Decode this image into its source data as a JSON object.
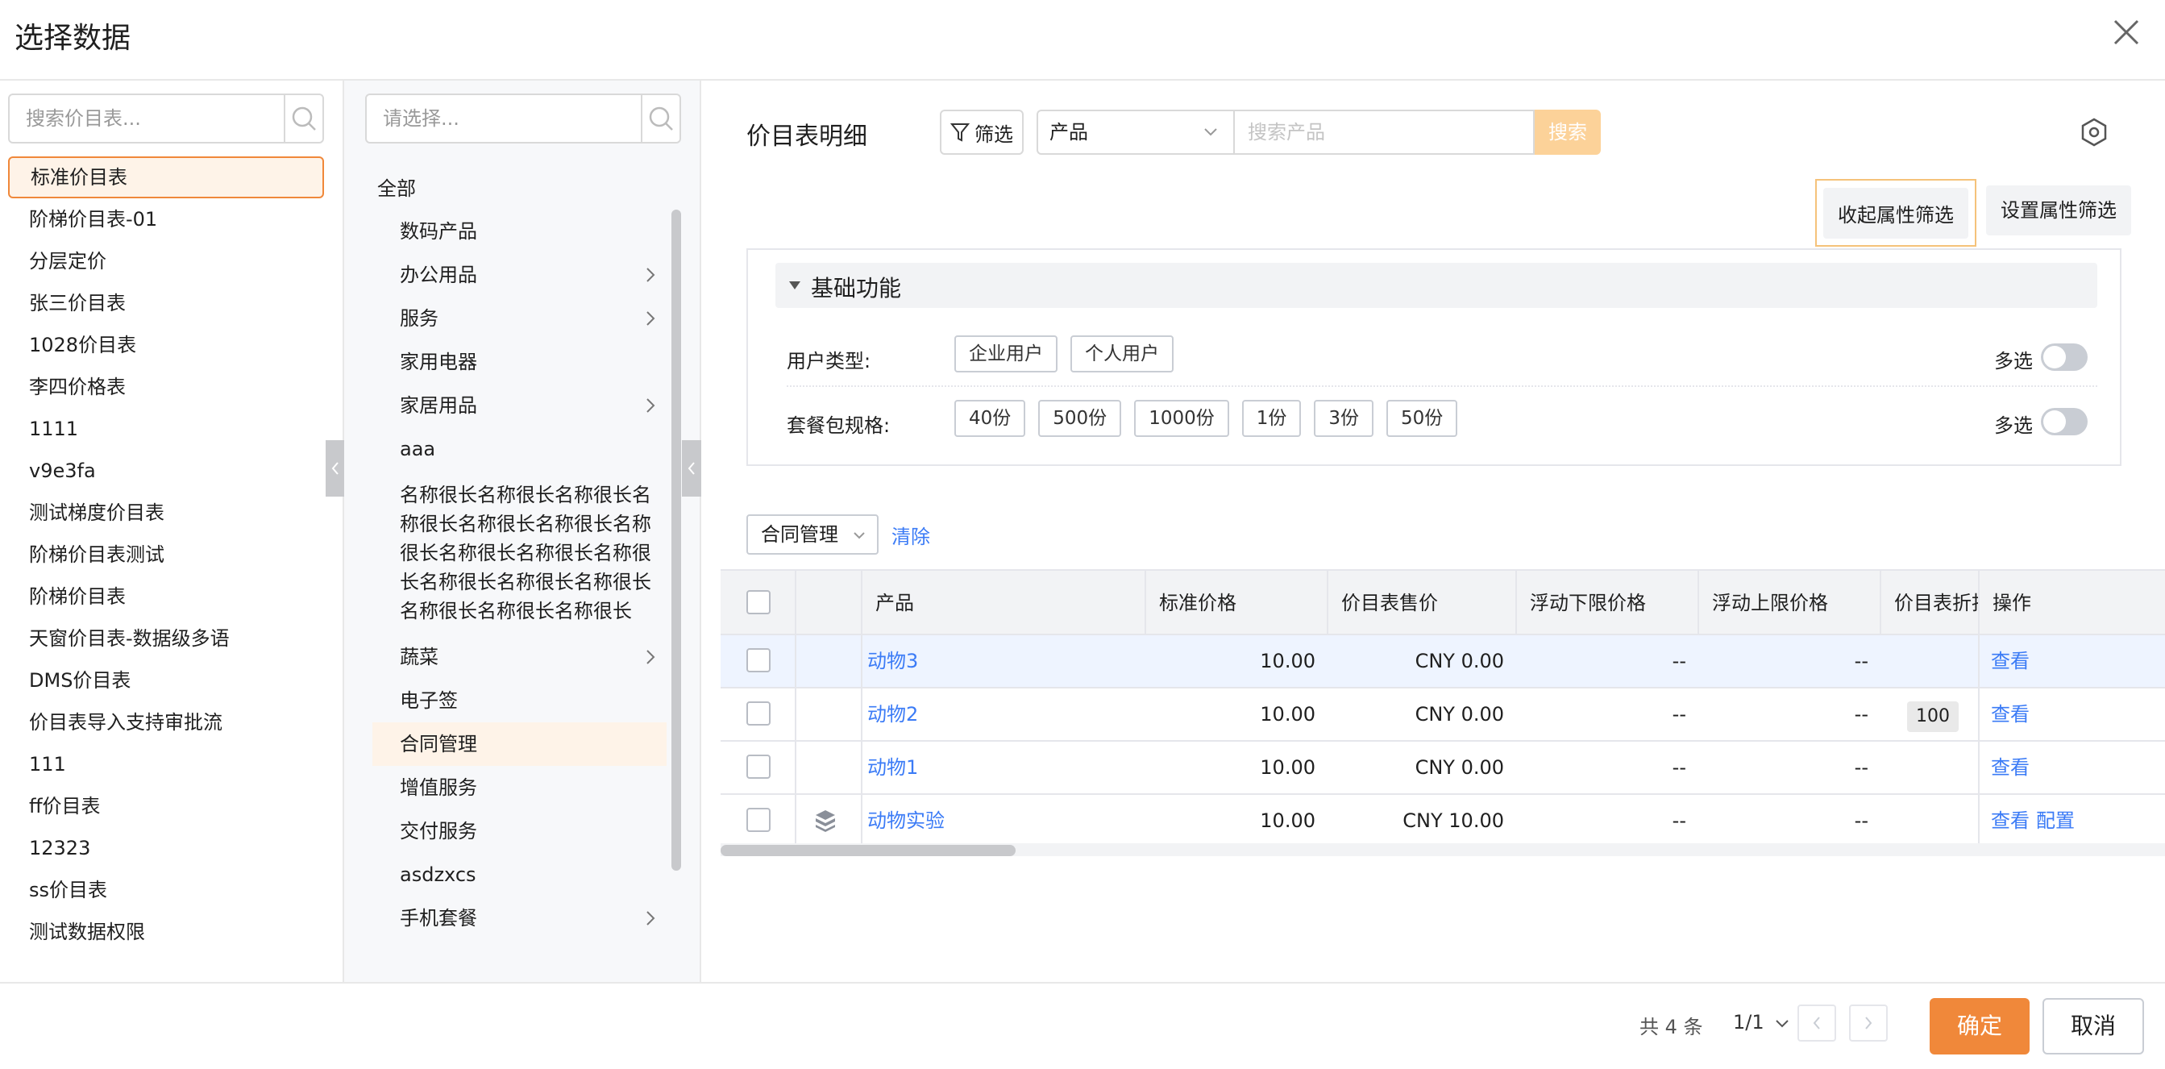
{
  "dialog": {
    "title": "选择数据"
  },
  "price_lists": {
    "search_placeholder": "搜索价目表...",
    "items": [
      {
        "label": "标准价目表",
        "active": true
      },
      {
        "label": "阶梯价目表-01"
      },
      {
        "label": "分层定价"
      },
      {
        "label": "张三价目表"
      },
      {
        "label": "1028价目表"
      },
      {
        "label": "李四价格表"
      },
      {
        "label": "1111"
      },
      {
        "label": "v9e3fa"
      },
      {
        "label": "测试梯度价目表"
      },
      {
        "label": "阶梯价目表测试"
      },
      {
        "label": "阶梯价目表"
      },
      {
        "label": "天窗价目表-数据级多语"
      },
      {
        "label": "DMS价目表"
      },
      {
        "label": "价目表导入支持审批流"
      },
      {
        "label": "111"
      },
      {
        "label": "ff价目表"
      },
      {
        "label": "12323"
      },
      {
        "label": "ss价目表"
      },
      {
        "label": "测试数据权限"
      }
    ]
  },
  "categories": {
    "search_placeholder": "请选择...",
    "root": "全部",
    "items": [
      {
        "label": "数码产品",
        "has_children": false
      },
      {
        "label": "办公用品",
        "has_children": true
      },
      {
        "label": "服务",
        "has_children": true
      },
      {
        "label": "家用电器",
        "has_children": false
      },
      {
        "label": "家居用品",
        "has_children": true
      },
      {
        "label": "aaa",
        "has_children": false
      },
      {
        "label": "名称很长名称很长名称很长名称很长名称很长名称很长名称很长名称很长名称很长名称很长名称很长名称很长名称很长名称很长名称很长名称很长",
        "has_children": false,
        "multiline": true
      },
      {
        "label": "蔬菜",
        "has_children": true
      },
      {
        "label": "电子签",
        "has_children": false
      },
      {
        "label": "合同管理",
        "has_children": false,
        "active": true
      },
      {
        "label": "增值服务",
        "has_children": false
      },
      {
        "label": "交付服务",
        "has_children": false
      },
      {
        "label": "asdzxcs",
        "has_children": false
      },
      {
        "label": "手机套餐",
        "has_children": true
      }
    ]
  },
  "detail": {
    "title": "价目表明细",
    "filter_label": "筛选",
    "field_select": "产品",
    "search_placeholder": "搜索产品",
    "search_label": "搜索",
    "collapse_attr_label": "收起属性筛选",
    "set_attr_label": "设置属性筛选",
    "panel": {
      "section_label": "基础功能",
      "rows": [
        {
          "label": "用户类型:",
          "tags": [
            "企业用户",
            "个人用户"
          ],
          "multi_label": "多选",
          "multi_on": false
        },
        {
          "label": "套餐包规格:",
          "tags": [
            "40份",
            "500份",
            "1000份",
            "1份",
            "3份",
            "50份"
          ],
          "multi_label": "多选",
          "multi_on": false
        }
      ]
    },
    "category_filter": "合同管理",
    "clear_label": "清除"
  },
  "table": {
    "columns": [
      "产品",
      "标准价格",
      "价目表售价",
      "浮动下限价格",
      "浮动上限价格",
      "价目表折扣",
      "操作"
    ],
    "rows": [
      {
        "product": "动物3",
        "std_price": "10.00",
        "sale_price": "CNY 0.00",
        "low": "--",
        "high": "--",
        "discount": "",
        "actions": [
          "查看"
        ],
        "highlight": true,
        "icon": false
      },
      {
        "product": "动物2",
        "std_price": "10.00",
        "sale_price": "CNY 0.00",
        "low": "--",
        "high": "--",
        "discount": "100",
        "actions": [
          "查看"
        ],
        "highlight": false,
        "icon": false
      },
      {
        "product": "动物1",
        "std_price": "10.00",
        "sale_price": "CNY 0.00",
        "low": "--",
        "high": "--",
        "discount": "",
        "actions": [
          "查看"
        ],
        "highlight": false,
        "icon": false
      },
      {
        "product": "动物实验",
        "std_price": "10.00",
        "sale_price": "CNY 10.00",
        "low": "--",
        "high": "--",
        "discount": "",
        "actions": [
          "查看",
          "配置"
        ],
        "highlight": false,
        "icon": true
      }
    ]
  },
  "footer": {
    "total": "共 4 条",
    "page": "1/1",
    "ok_label": "确定",
    "cancel_label": "取消"
  },
  "colors": {
    "accent": "#f0883a",
    "link": "#3b7bf6",
    "search_btn": "#fcd299"
  }
}
